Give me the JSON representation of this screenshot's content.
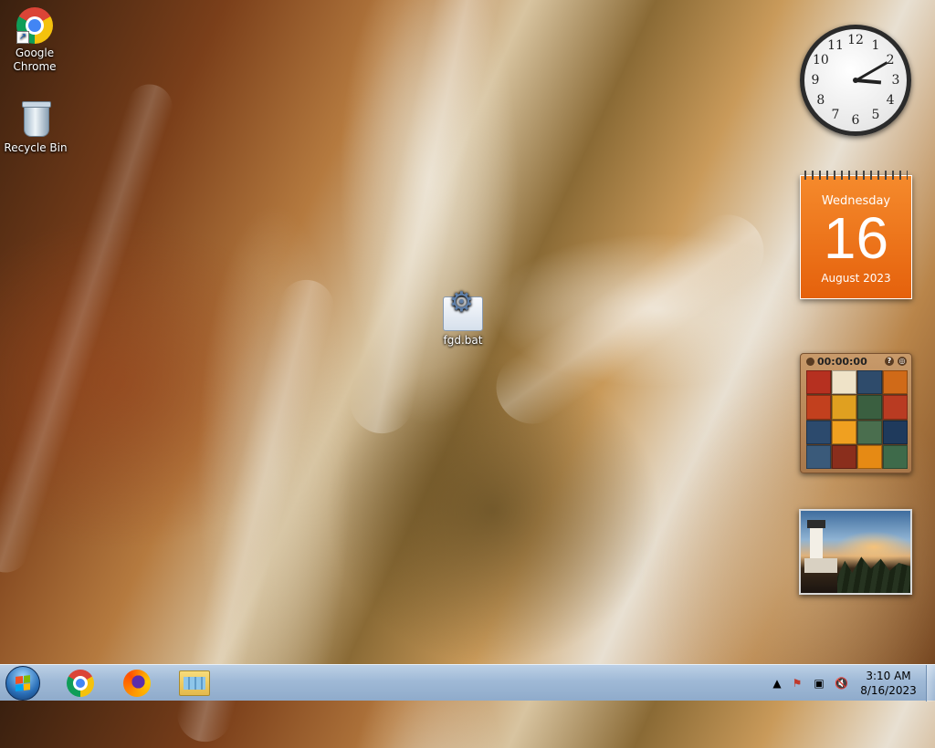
{
  "desktop": {
    "icons": [
      {
        "label_line1": "Google",
        "label_line2": "Chrome",
        "icon": "chrome-icon"
      },
      {
        "label": "Recycle Bin",
        "icon": "recycle-bin-icon"
      },
      {
        "label": "fgd.bat",
        "icon": "batch-file-icon"
      }
    ]
  },
  "gadgets": {
    "clock": {
      "numbers": [
        "12",
        "1",
        "2",
        "3",
        "4",
        "5",
        "6",
        "7",
        "8",
        "9",
        "10",
        "11"
      ],
      "hour": 3,
      "minute": 10
    },
    "calendar": {
      "weekday": "Wednesday",
      "day": "16",
      "month_year": "August 2023"
    },
    "puzzle": {
      "timer": "00:00:00",
      "tile_colors": [
        "#b63020",
        "#efe3c8",
        "#2e4b6b",
        "#d06a18",
        "#c2401e",
        "#e0a020",
        "#3a5f40",
        "#b93b22",
        "#2c4a6d",
        "#f0a020",
        "#4a6e4e",
        "#1f3a5c",
        "#3a5a7a",
        "#8a2e1c",
        "#e68a14",
        "#3e6a4a"
      ]
    },
    "slideshow": {
      "subject": "lighthouse-photo"
    }
  },
  "taskbar": {
    "start_icon": "windows-start-icon",
    "pinned": [
      "chrome-icon",
      "firefox-icon",
      "file-explorer-icon"
    ],
    "tray": {
      "time": "3:10 AM",
      "date": "8/16/2023",
      "icons": [
        "show-hidden-icons-icon",
        "action-center-flag-icon",
        "network-icon",
        "volume-muted-icon"
      ]
    }
  }
}
